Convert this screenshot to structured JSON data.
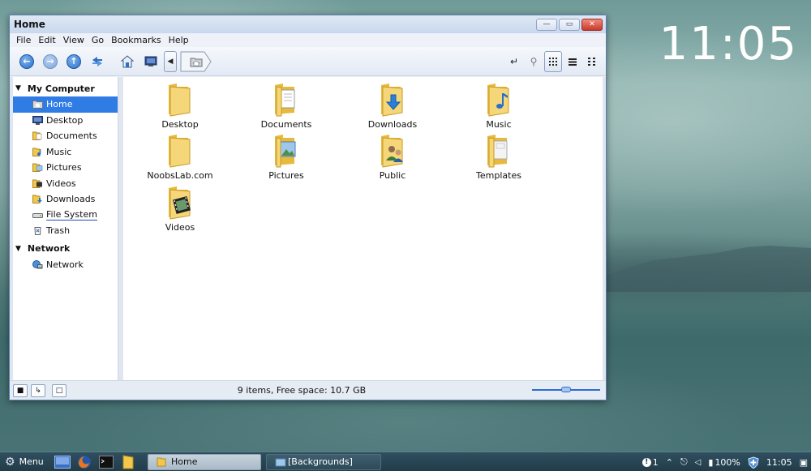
{
  "desktop": {
    "clock": "11:05"
  },
  "window": {
    "title": "Home",
    "buttons": {
      "minimize": "—",
      "maximize": "▭",
      "close": "✕"
    },
    "menu": [
      "File",
      "Edit",
      "View",
      "Go",
      "Bookmarks",
      "Help"
    ]
  },
  "toolbar": {
    "icons": [
      "back-icon",
      "forward-icon",
      "up-icon",
      "reload-icon",
      "home-icon",
      "computer-icon",
      "path-back-icon",
      "home-folder-crumb-icon",
      "open-terminal-icon",
      "search-icon",
      "icon-view-icon",
      "list-view-icon",
      "compact-view-icon"
    ]
  },
  "sidebar": {
    "sections": [
      {
        "label": "My Computer",
        "items": [
          {
            "label": "Home",
            "icon": "home-icon",
            "selected": true
          },
          {
            "label": "Desktop",
            "icon": "desktop-icon"
          },
          {
            "label": "Documents",
            "icon": "folder-icon"
          },
          {
            "label": "Music",
            "icon": "folder-icon"
          },
          {
            "label": "Pictures",
            "icon": "folder-icon"
          },
          {
            "label": "Videos",
            "icon": "folder-icon"
          },
          {
            "label": "Downloads",
            "icon": "folder-icon"
          },
          {
            "label": "File System",
            "icon": "drive-icon"
          },
          {
            "label": "Trash",
            "icon": "trash-icon"
          }
        ]
      },
      {
        "label": "Network",
        "items": [
          {
            "label": "Network",
            "icon": "network-icon"
          }
        ]
      }
    ]
  },
  "files": [
    {
      "name": "Desktop",
      "emblem": "none"
    },
    {
      "name": "Documents",
      "emblem": "document"
    },
    {
      "name": "Downloads",
      "emblem": "download-arrow"
    },
    {
      "name": "Music",
      "emblem": "music-note"
    },
    {
      "name": "NoobsLab.com",
      "emblem": "none"
    },
    {
      "name": "Pictures",
      "emblem": "picture"
    },
    {
      "name": "Public",
      "emblem": "people"
    },
    {
      "name": "Templates",
      "emblem": "template"
    },
    {
      "name": "Videos",
      "emblem": "film"
    }
  ],
  "status": {
    "text": "9 items, Free space: 10.7 GB",
    "zoom_level": 0.5
  },
  "taskbar": {
    "menu_label": "Menu",
    "tasks": [
      {
        "label": "Home",
        "active": true
      },
      {
        "label": "[Backgrounds]",
        "active": false
      }
    ],
    "tray": {
      "notifications": "1",
      "battery": "100%",
      "time": "11:05"
    }
  },
  "colors": {
    "selection": "#2f7ce4",
    "folder": "#f2c74e",
    "accent": "#2e6ccf"
  }
}
